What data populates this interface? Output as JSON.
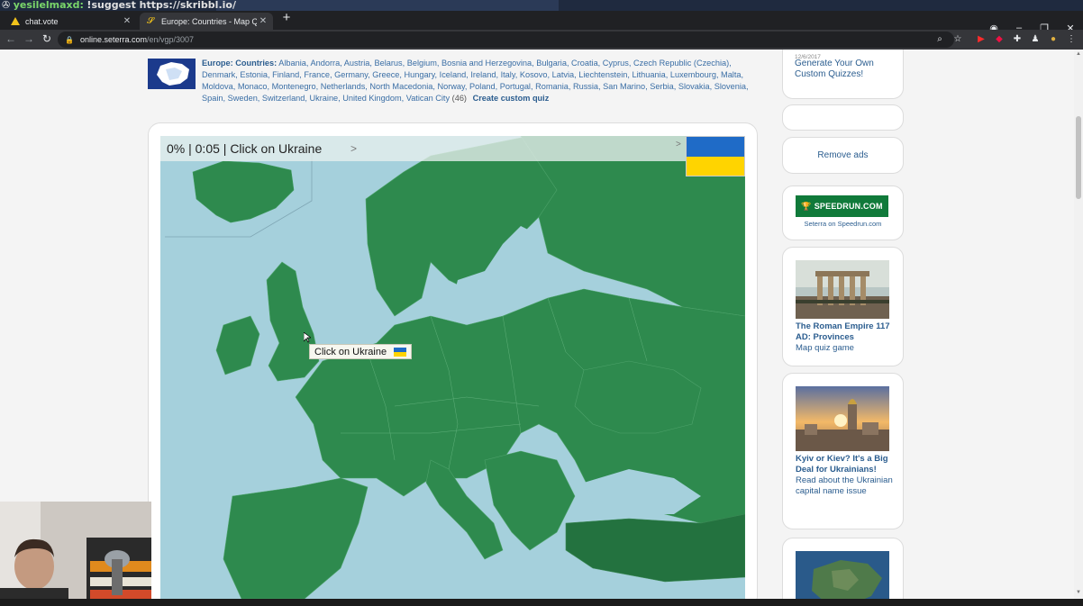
{
  "stream_chat": {
    "user": "yesilelmaxd:",
    "message": "!suggest https://skribbl.io/"
  },
  "tabs": [
    {
      "title": "chat.vote",
      "active": false
    },
    {
      "title": "Europe: Countries - Map Quiz Ga",
      "active": true
    }
  ],
  "address": {
    "domain": "online.seterra.com",
    "path": "/en/vgp/3007"
  },
  "country_list": {
    "lead": "Europe: Countries:",
    "countries": "Albania, Andorra, Austria, Belarus, Belgium, Bosnia and Herzegovina, Bulgaria, Croatia, Cyprus, Czech Republic (Czechia), Denmark, Estonia, Finland, France, Germany, Greece, Hungary, Iceland, Ireland, Italy, Kosovo, Latvia, Liechtenstein, Lithuania, Luxembourg, Malta, Moldova, Monaco, Montenegro, Netherlands, North Macedonia, Norway, Poland, Portugal, Romania, Russia, San Marino, Serbia, Slovakia, Slovenia, Spain, Sweden, Switzerland, Ukraine, United Kingdom, Vatican City",
    "count": "(46)",
    "custom_link": "Create custom quiz"
  },
  "quiz": {
    "status": "0% | 0:05 | Click on Ukraine",
    "next_arrow": ">",
    "settings_arrow": ">",
    "tooltip": "Click on Ukraine",
    "target_flag": "ukraine-flag",
    "colors": {
      "land": "#2e8a4e",
      "land_dark": "#23723f",
      "water": "#a5d0dc",
      "flag_blue": "#1f6bc7",
      "flag_yellow": "#ffd400"
    }
  },
  "sidebar": {
    "generate_date": "12/6/2017",
    "generate_link": "Generate Your Own Custom Quizzes!",
    "remove_ads": "Remove ads",
    "speedrun_logo": "SPEEDRUN.COM",
    "speedrun_caption": "Seterra on Speedrun.com",
    "rome_title": "The Roman Empire 117 AD: Provinces",
    "rome_sub": "Map quiz game",
    "kyiv_title": "Kyiv or Kiev? It's a Big Deal for Ukrainians!",
    "kyiv_sub": "Read about the Ukrainian capital name issue"
  }
}
